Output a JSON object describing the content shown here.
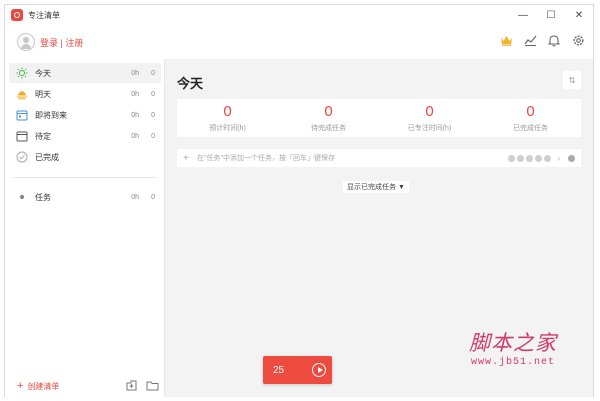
{
  "app": {
    "title": "专注清单"
  },
  "window_controls": {
    "minimize": "—",
    "maximize": "☐",
    "close": "✕"
  },
  "header": {
    "login_text": "登录 | 注册"
  },
  "sidebar": {
    "items": [
      {
        "label": "今天",
        "time": "0h",
        "count": "0"
      },
      {
        "label": "明天",
        "time": "0h",
        "count": "0"
      },
      {
        "label": "即将到来",
        "time": "0h",
        "count": "0"
      },
      {
        "label": "待定",
        "time": "0h",
        "count": "0"
      },
      {
        "label": "已完成"
      },
      {
        "label": "任务",
        "time": "0h",
        "count": "0"
      }
    ],
    "create_list": "创建清单"
  },
  "main": {
    "title": "今天",
    "sort_icon": "⇅",
    "stats": [
      {
        "value": "0",
        "label": "预计时间(h)"
      },
      {
        "value": "0",
        "label": "待完成任务"
      },
      {
        "value": "0",
        "label": "已专注时间(h)"
      },
      {
        "value": "0",
        "label": "已完成任务"
      }
    ],
    "add_task_placeholder": "在\"任务\"中添加一个任务，按「回车」键保存",
    "show_completed": "显示已完成任务",
    "show_completed_arrow": "▼"
  },
  "timer": {
    "value": "25"
  },
  "watermark": {
    "text": "脚本之家",
    "url": "www.jb51.net"
  },
  "colors": {
    "accent": "#e8483f",
    "background": "#f3f3f3"
  }
}
